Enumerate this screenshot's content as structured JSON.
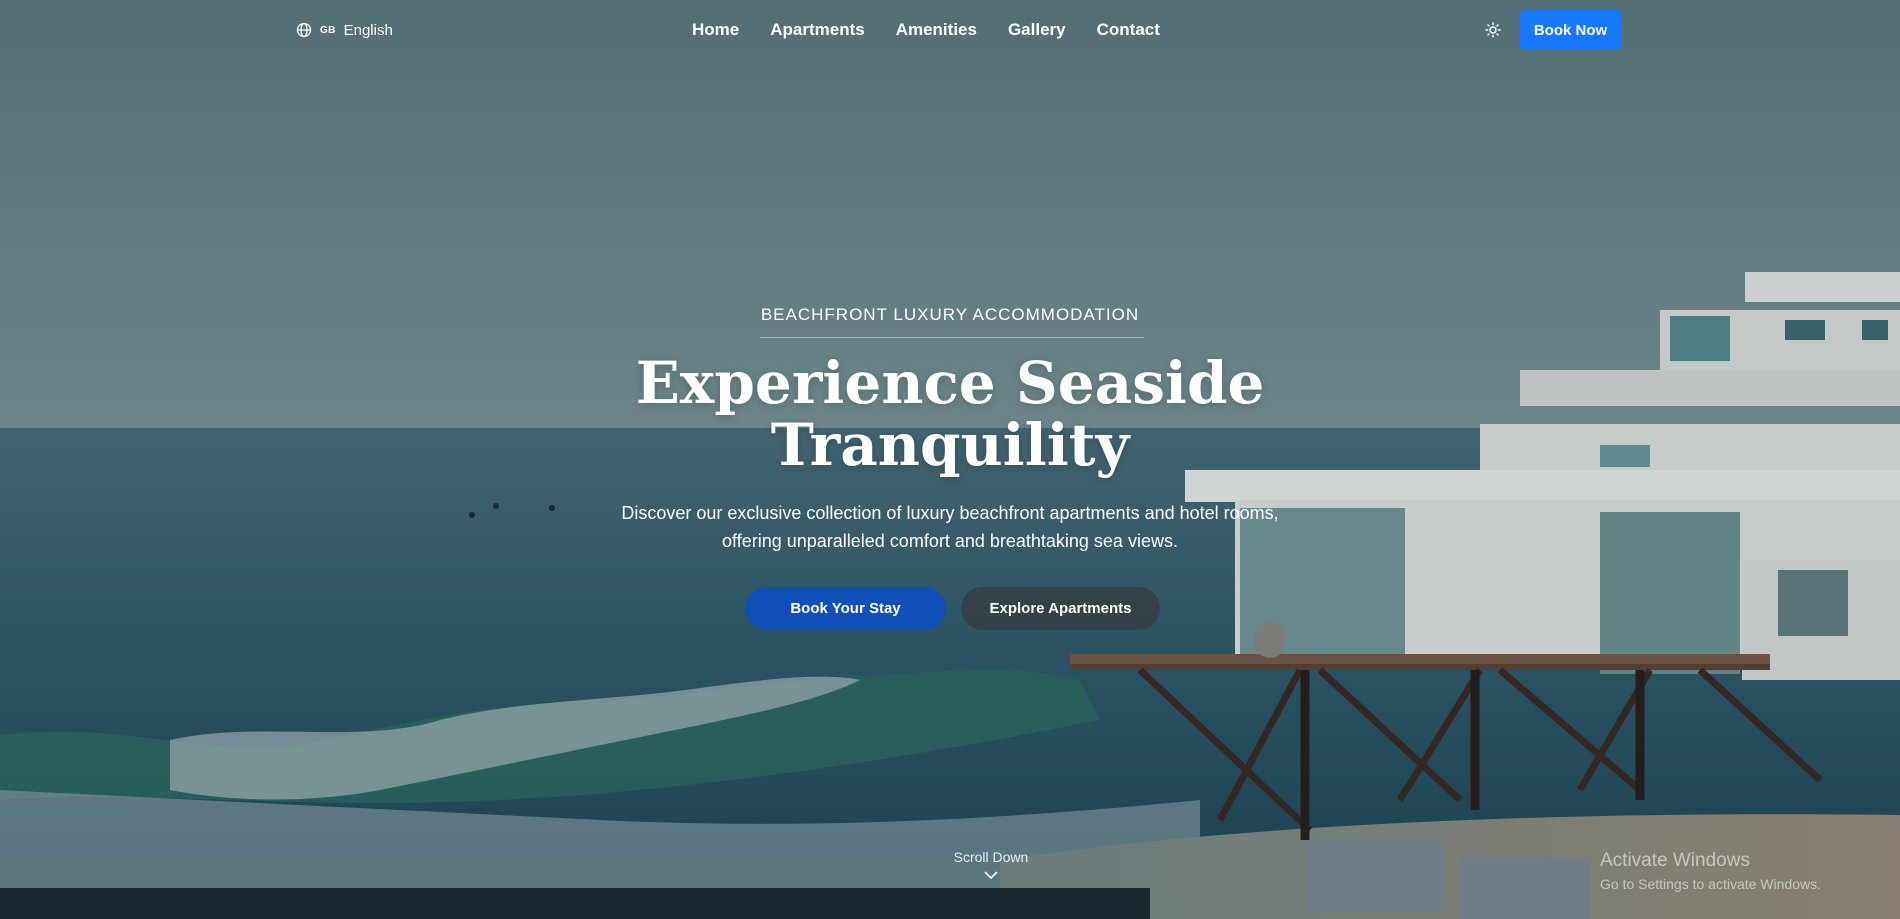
{
  "nav": {
    "language": {
      "flag": "GB",
      "label": "English",
      "icon": "globe-icon"
    },
    "items": [
      {
        "label": "Home"
      },
      {
        "label": "Apartments"
      },
      {
        "label": "Amenities"
      },
      {
        "label": "Gallery"
      },
      {
        "label": "Contact"
      }
    ],
    "theme_icon": "sun-icon",
    "book_now": "Book Now"
  },
  "hero": {
    "eyebrow": "BEACHFRONT LUXURY ACCOMMODATION",
    "headline_line1": "Experience Seaside",
    "headline_line2": "Tranquility",
    "subtext": "Discover our exclusive collection of luxury beachfront apartments and hotel rooms, offering unparalleled comfort and breathtaking sea views.",
    "primary_cta": "Book Your Stay",
    "secondary_cta": "Explore Apartments",
    "scroll_label": "Scroll Down",
    "scroll_icon": "chevron-down-icon"
  },
  "watermark": {
    "title": "Activate Windows",
    "subtitle": "Go to Settings to activate Windows."
  },
  "colors": {
    "primary_button": "#1677ff",
    "cta_button": "#0f4fb7",
    "secondary_button": "#323e42"
  }
}
